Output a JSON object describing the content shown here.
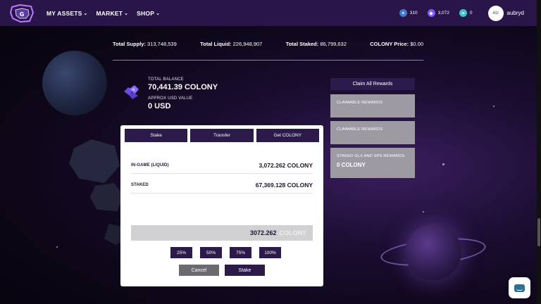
{
  "nav": {
    "items": [
      {
        "label": "MY ASSETS"
      },
      {
        "label": "MARKET"
      },
      {
        "label": "SHOP"
      }
    ],
    "stats": [
      {
        "icon": "plus-star-icon",
        "value": "310",
        "color": "#3a7bd5"
      },
      {
        "icon": "crystal-icon",
        "value": "3,072",
        "color": "#7b5cff"
      },
      {
        "icon": "feather-icon",
        "value": "0",
        "color": "#3fc1c9"
      }
    ],
    "avatar_initials": "AU",
    "username": "aubryd"
  },
  "totals": {
    "supply_label": "Total Supply:",
    "supply_value": "313,748,539",
    "liquid_label": "Total Liquid:",
    "liquid_value": "226,948,907",
    "staked_label": "Total Staked:",
    "staked_value": "86,799,632",
    "price_label": "COLONY Price:",
    "price_value": "$0.00"
  },
  "balance": {
    "total_label": "TOTAL BALANCE",
    "total_value": "70,441.39 COLONY",
    "usd_label": "APPROX USD VALUE",
    "usd_value": "0 USD"
  },
  "rewards": {
    "claim_all_label": "Claim All Rewards",
    "cards": [
      {
        "label": "CLAIMABLE REWARDS",
        "value": ""
      },
      {
        "label": "CLAIMABLE REWARDS",
        "value": ""
      },
      {
        "label": "STAKED GLX AND SPS REWARDS",
        "value": "0 COLONY"
      }
    ]
  },
  "modal": {
    "tabs": [
      {
        "label": "Stake"
      },
      {
        "label": "Transfer"
      },
      {
        "label": "Get COLONY"
      }
    ],
    "rows": [
      {
        "label": "IN-GAME (LIQUID)",
        "value": "3,072.262 COLONY"
      },
      {
        "label": "STAKED",
        "value": "67,369.128 COLONY"
      }
    ],
    "amount_value": "3072.262",
    "amount_unit": "COLONY",
    "percent_buttons": [
      "25%",
      "50%",
      "75%",
      "100%"
    ],
    "cancel_label": "Cancel",
    "stake_label": "Stake"
  }
}
